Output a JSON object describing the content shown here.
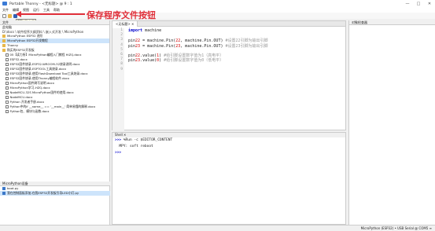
{
  "window": {
    "title": "Portable Thonny - <无标题> @ 9 : 1",
    "min": "—",
    "max": "□",
    "close": "✕"
  },
  "menu": [
    "文件",
    "编辑",
    "视图",
    "运行",
    "工具",
    "帮助"
  ],
  "annotation": "保存程序文件按钮",
  "tooltip": "保存 (Ctrl+S)",
  "files": {
    "title": "文件",
    "local_label": "此电脑",
    "path": "D:\\docs \\ 软件程序大纲资料 \\ 嵌入式开发 \\ MicroPython",
    "items": [
      {
        "name": "MicroPython ESP32 进阶",
        "type": "folder",
        "state": ""
      },
      {
        "name": "MicroPython ESP32开发教程",
        "type": "folder",
        "state": "selected"
      },
      {
        "name": "Thonny",
        "type": "folder",
        "state": ""
      },
      {
        "name": "购买的ESP32开发板",
        "type": "folder",
        "state": ""
      },
      {
        "name": "05【读力所】MicroPython编程入门教程 HiZQ.docx",
        "type": "file",
        "state": ""
      },
      {
        "name": "ESP32.docx",
        "type": "file",
        "state": ""
      },
      {
        "name": "ESP32固件烧录-ESP32-WROOM-32烧录说明.docx",
        "type": "file",
        "state": ""
      },
      {
        "name": "ESP32固件烧录-ESPTOOL工具烧录.docx",
        "type": "file",
        "state": ""
      },
      {
        "name": "ESP32固件烧录-使用FlashDownload Tool工具烧录.docx",
        "type": "file",
        "state": ""
      },
      {
        "name": "ESP32固件烧录-使用Thonny编程软件.docx",
        "type": "file",
        "state": ""
      },
      {
        "name": "MicroPython固件刷写说明.docx",
        "type": "file",
        "state": ""
      },
      {
        "name": "MicroPython学习-HZQ.docx",
        "type": "file",
        "state": ""
      },
      {
        "name": "NodeMCU-32S MicroPython固件的使用.docx",
        "type": "file",
        "state": ""
      },
      {
        "name": "NodeMCU.docx",
        "type": "file",
        "state": ""
      },
      {
        "name": "Python 开发者手册.docx",
        "type": "file",
        "state": ""
      },
      {
        "name": "Python中的if __name__ == '__main__' 简单易懂的解释.docx",
        "type": "file",
        "state": ""
      },
      {
        "name": "Python包、模块与函数.docx",
        "type": "file",
        "state": ""
      }
    ],
    "device_label": "MicroPython设备",
    "device_items": [
      {
        "name": "boot.py",
        "state": ""
      },
      {
        "name": "我在控制面板添加-在我ESP32开发板引导LED小灯.py",
        "state": "active"
      }
    ]
  },
  "editor": {
    "tab": "<无标题> ✕",
    "lines": [
      {
        "n": "1",
        "text": "import machine",
        "comment": ""
      },
      {
        "n": "2",
        "text": "",
        "comment": ""
      },
      {
        "n": "3",
        "text": "pin22 = machine.Pin(22, machine.Pin.OUT)",
        "comment": " #设置22引脚为输出引脚"
      },
      {
        "n": "4",
        "text": "pin23 = machine.Pin(23, machine.Pin.OUT)",
        "comment": " #设置23引脚为输出引脚"
      },
      {
        "n": "5",
        "text": "",
        "comment": ""
      },
      {
        "n": "6",
        "text": "pin22.value(1)",
        "comment": " #给引脚设置数字值为1（高电平）"
      },
      {
        "n": "7",
        "text": "pin23.value(0)",
        "comment": " #给引脚设置数字值为0（低电平）"
      },
      {
        "n": "8",
        "text": "",
        "comment": ""
      },
      {
        "n": "9",
        "text": "",
        "comment": ""
      }
    ]
  },
  "shell": {
    "title": "Shell ✕",
    "prompt": ">>>",
    "cmd": " %Run -c $EDITOR_CONTENT",
    "output": "MPY: soft reboot"
  },
  "right_panel": {
    "title": "对象检查器"
  },
  "status": "MicroPython (ESP32) • USB Serial @ COM5 ≡"
}
